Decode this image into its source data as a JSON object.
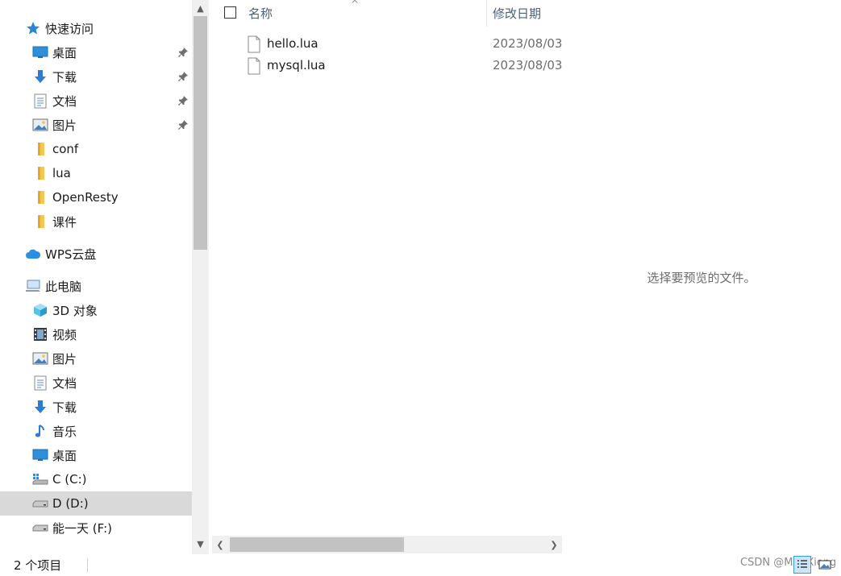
{
  "nav": {
    "quick_access": "快速访问",
    "quick_items": [
      {
        "label": "桌面"
      },
      {
        "label": "下载"
      },
      {
        "label": "文档"
      },
      {
        "label": "图片"
      },
      {
        "label": "conf"
      },
      {
        "label": "lua"
      },
      {
        "label": "OpenResty"
      },
      {
        "label": "课件"
      }
    ],
    "wps": "WPS云盘",
    "this_pc": "此电脑",
    "pc_items": [
      {
        "label": "3D 对象"
      },
      {
        "label": "视频"
      },
      {
        "label": "图片"
      },
      {
        "label": "文档"
      },
      {
        "label": "下载"
      },
      {
        "label": "音乐"
      },
      {
        "label": "桌面"
      },
      {
        "label": "C (C:)"
      },
      {
        "label": "D (D:)"
      },
      {
        "label": "能一天 (F:)"
      }
    ]
  },
  "list": {
    "col_name": "名称",
    "col_date": "修改日期",
    "files": [
      {
        "name": "hello.lua",
        "date": "2023/08/03"
      },
      {
        "name": "mysql.lua",
        "date": "2023/08/03"
      }
    ]
  },
  "preview": {
    "message": "选择要预览的文件。"
  },
  "status": {
    "count": "2 个项目",
    "watermark": "CSDN @MeBXiong"
  },
  "colors": {
    "accent": "#3c9be5",
    "selected_bg": "#d9d9d9",
    "header_text": "#4c607a"
  }
}
